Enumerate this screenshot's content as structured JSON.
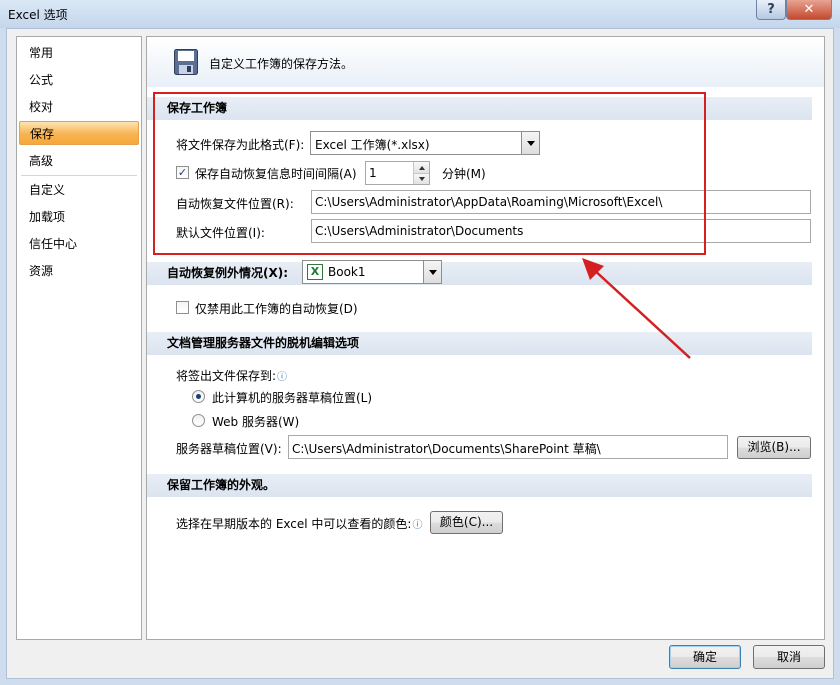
{
  "window": {
    "title": "Excel 选项",
    "help_label": "?",
    "close_label": "✕"
  },
  "nav": {
    "items": [
      {
        "label": "常用"
      },
      {
        "label": "公式"
      },
      {
        "label": "校对"
      },
      {
        "label": "保存",
        "selected": true
      },
      {
        "label": "高级"
      },
      {
        "label": "自定义"
      },
      {
        "label": "加载项"
      },
      {
        "label": "信任中心"
      },
      {
        "label": "资源"
      }
    ]
  },
  "header": {
    "text": "自定义工作簿的保存方法。",
    "icon": "save-disk-icon"
  },
  "save_workbooks": {
    "title": "保存工作簿",
    "format_label": "将文件保存为此格式(F):",
    "format_value": "Excel 工作簿(*.xlsx)",
    "autorecover_checked": true,
    "autorecover_label": "保存自动恢复信息时间间隔(A)",
    "autorecover_minutes": "1",
    "minutes_label": "分钟(M)",
    "autorecover_location_label": "自动恢复文件位置(R):",
    "autorecover_location_value": "C:\\Users\\Administrator\\AppData\\Roaming\\Microsoft\\Excel\\",
    "default_location_label": "默认文件位置(I):",
    "default_location_value": "C:\\Users\\Administrator\\Documents"
  },
  "autorecover_exceptions": {
    "title": "自动恢复例外情况(X):",
    "workbook_value": "Book1",
    "disable_checked": false,
    "disable_label": "仅禁用此工作簿的自动恢复(D)"
  },
  "offline_editing": {
    "title": "文档管理服务器文件的脱机编辑选项",
    "save_to_label": "将签出文件保存到:",
    "option_local": "此计算机的服务器草稿位置(L)",
    "option_web": "Web 服务器(W)",
    "selected": "local",
    "drafts_label": "服务器草稿位置(V):",
    "drafts_value": "C:\\Users\\Administrator\\Documents\\SharePoint 草稿\\",
    "browse_label": "浏览(B)..."
  },
  "preserve_visual": {
    "title": "保留工作簿的外观。",
    "colors_label": "选择在早期版本的 Excel 中可以查看的颜色:",
    "colors_button": "颜色(C)..."
  },
  "footer": {
    "ok_label": "确定",
    "cancel_label": "取消"
  },
  "annotation": {
    "highlight_color": "#d42020"
  }
}
